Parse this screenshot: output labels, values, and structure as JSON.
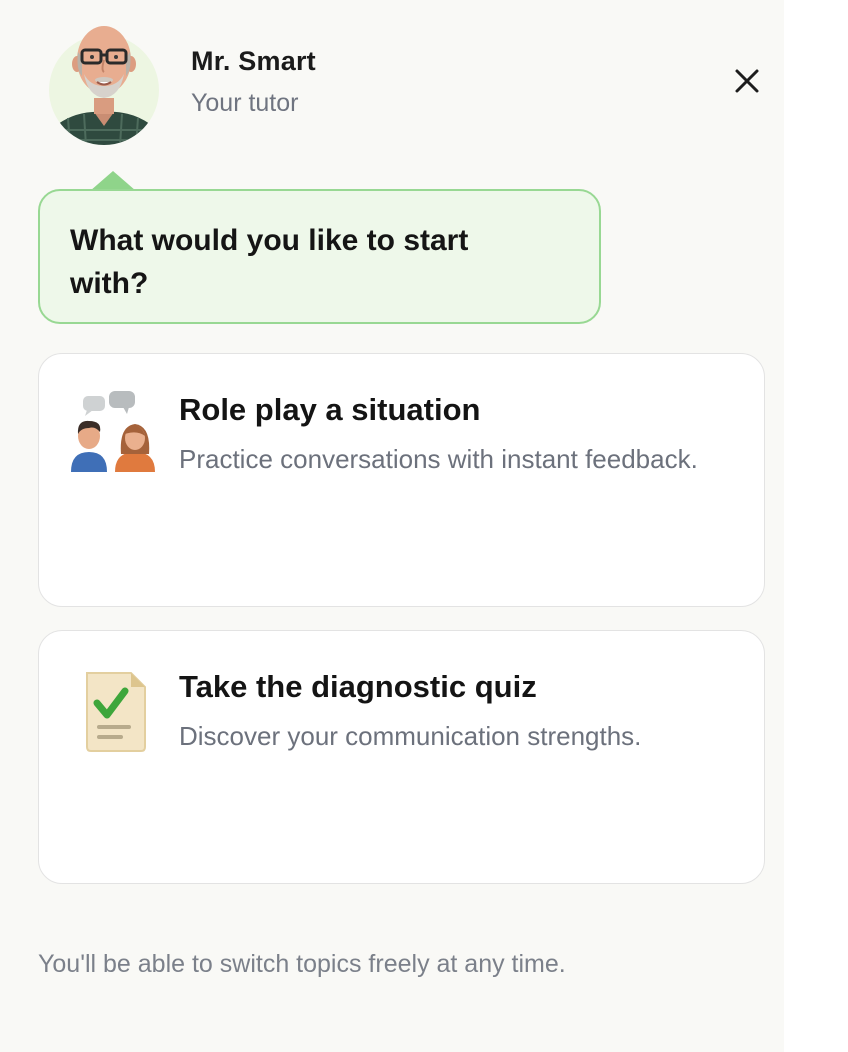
{
  "tutor": {
    "name": "Mr. Smart",
    "role": "Your tutor"
  },
  "prompt": {
    "question": "What would you like to start with?"
  },
  "options": [
    {
      "icon": "conversation-people-icon",
      "title": "Role play a situation",
      "description": "Practice conversations with instant feedback."
    },
    {
      "icon": "checklist-document-icon",
      "title": "Take the diagnostic quiz",
      "description": "Discover your communication strengths."
    }
  ],
  "footer": {
    "note": "You'll be able to switch topics freely at any time."
  },
  "colors": {
    "bubble_background": "#eef8ea",
    "bubble_border": "#98d893",
    "panel_background": "#f9f9f6",
    "muted_text": "#6c717c"
  }
}
